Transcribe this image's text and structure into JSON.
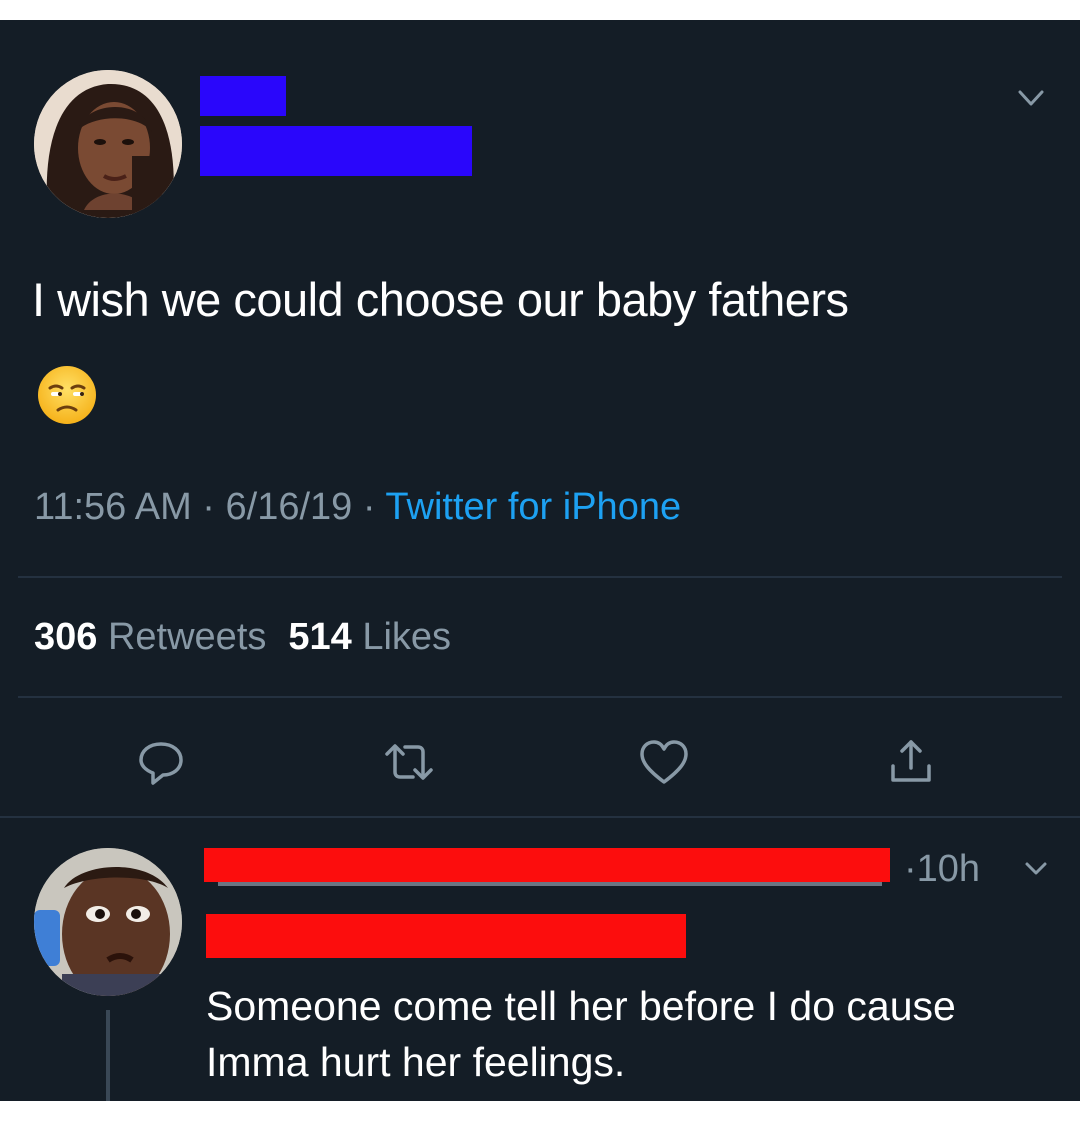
{
  "tweet": {
    "text": "I wish we could choose our baby fathers",
    "emoji": "unamused-face",
    "time": "11:56 AM",
    "date": "6/16/19",
    "source": "Twitter for iPhone",
    "retweets_count": "306",
    "retweets_label": "Retweets",
    "likes_count": "514",
    "likes_label": "Likes"
  },
  "actions": [
    {
      "name": "reply",
      "icon": "comment-icon"
    },
    {
      "name": "retweet",
      "icon": "retweet-icon"
    },
    {
      "name": "like",
      "icon": "heart-icon"
    },
    {
      "name": "share",
      "icon": "share-icon"
    }
  ],
  "reply": {
    "time": "10h",
    "text_line1": "Someone come tell her before I do cause",
    "text_line2": "Imma hurt her feelings."
  },
  "colors": {
    "background": "#141d26",
    "text": "#ffffff",
    "secondary": "#8899a6",
    "link": "#1da1f2",
    "redaction_blue": "#2a06fb",
    "redaction_red": "#fc0d0d"
  }
}
